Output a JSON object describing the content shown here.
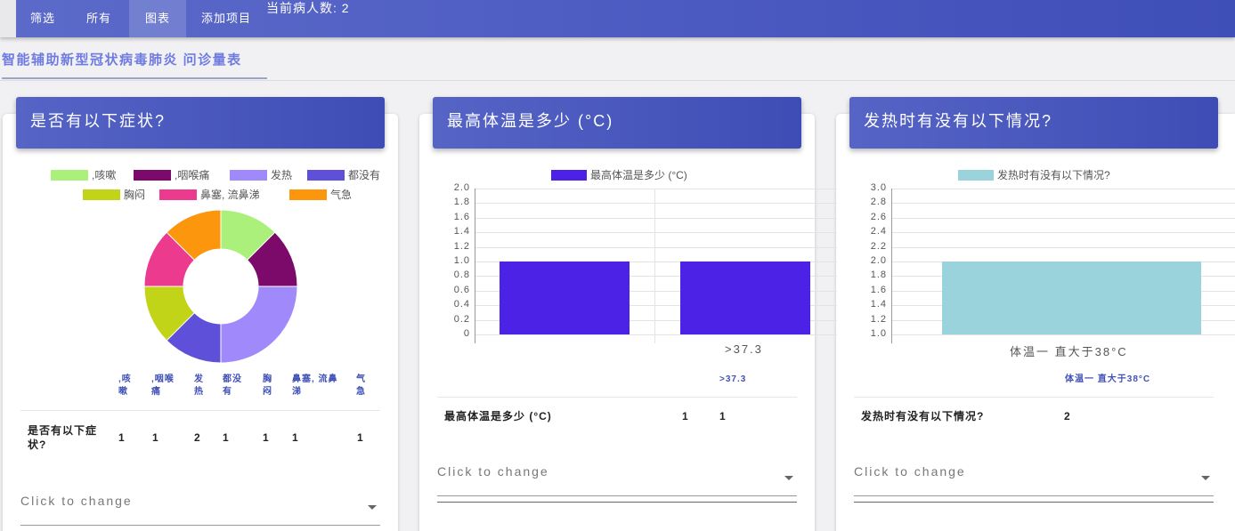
{
  "nav": {
    "tabs": [
      {
        "label": "筛选"
      },
      {
        "label": "所有"
      },
      {
        "label": "图表"
      },
      {
        "label": "添加项目"
      }
    ],
    "patient_count": "当前病人数: 2"
  },
  "page_title": "智能辅助新型冠状病毒肺炎 问诊量表",
  "cards": [
    {
      "title": "是否有以下症状?",
      "legend": [
        {
          "label": ",咳嗽",
          "color": "#aaf07a"
        },
        {
          "label": ",咽喉痛",
          "color": "#7c0a6b"
        },
        {
          "label": "发热",
          "color": "#a089fa"
        },
        {
          "label": "都没有",
          "color": "#5e50d8"
        },
        {
          "label": "胸闷",
          "color": "#c2d418"
        },
        {
          "label": "鼻塞, 流鼻涕",
          "color": "#ec3b8f"
        },
        {
          "label": "气急",
          "color": "#fc960c"
        }
      ],
      "table_headers": [
        ",咳嗽",
        ",咽喉痛",
        "发热",
        "都没有",
        "胸闷",
        "鼻塞, 流鼻涕",
        "气急"
      ],
      "table_row_label": "是否有以下症状?",
      "table_values": [
        "1",
        "1",
        "2",
        "1",
        "1",
        "1",
        "1"
      ],
      "select_placeholder": "Click to change"
    },
    {
      "title": "最高体温是多少 (°C)",
      "legend": [
        {
          "label": "最高体温是多少 (°C)",
          "color": "#4b22e6"
        }
      ],
      "table_headers": [
        ">37.3"
      ],
      "table_row_label": "最高体温是多少 (°C)",
      "table_values": [
        "1",
        "1"
      ],
      "select_placeholder": "Click to change"
    },
    {
      "title": "发热时有没有以下情况?",
      "legend": [
        {
          "label": "发热时有没有以下情况?",
          "color": "#9bd3dc"
        }
      ],
      "table_headers": [
        "体温一 直大于38°C"
      ],
      "table_row_label": "发热时有没有以下情况?",
      "table_values": [
        "2"
      ],
      "select_placeholder": "Click to change"
    }
  ],
  "chart_data": [
    {
      "type": "pie",
      "donut": true,
      "categories": [
        ",咳嗽",
        ",咽喉痛",
        "发热",
        "都没有",
        "胸闷",
        "鼻塞, 流鼻涕",
        "气急"
      ],
      "values": [
        1,
        1,
        2,
        1,
        1,
        1,
        1
      ],
      "colors": [
        "#aaf07a",
        "#7c0a6b",
        "#a089fa",
        "#5e50d8",
        "#c2d418",
        "#ec3b8f",
        "#fc960c"
      ],
      "legend_position": "top"
    },
    {
      "type": "bar",
      "categories": [
        "",
        ">37.3"
      ],
      "series": [
        {
          "name": "最高体温是多少 (°C)",
          "values": [
            1,
            1
          ],
          "color": "#4b22e6"
        }
      ],
      "ylim": [
        0,
        2.0
      ],
      "yticks": [
        "0",
        "0.2",
        "0.4",
        "0.6",
        "0.8",
        "1.0",
        "1.2",
        "1.4",
        "1.6",
        "1.8",
        "2.0"
      ],
      "grid": true,
      "legend_position": "top"
    },
    {
      "type": "bar",
      "categories": [
        "体温一 直大于38°C"
      ],
      "series": [
        {
          "name": "发热时有没有以下情况?",
          "values": [
            2
          ],
          "color": "#9bd3dc"
        }
      ],
      "ylim": [
        1.0,
        3.0
      ],
      "yticks": [
        "1.0",
        "1.2",
        "1.4",
        "1.6",
        "1.8",
        "2.0",
        "2.2",
        "2.4",
        "2.6",
        "2.8",
        "3.0"
      ],
      "grid": true,
      "legend_position": "top"
    }
  ]
}
